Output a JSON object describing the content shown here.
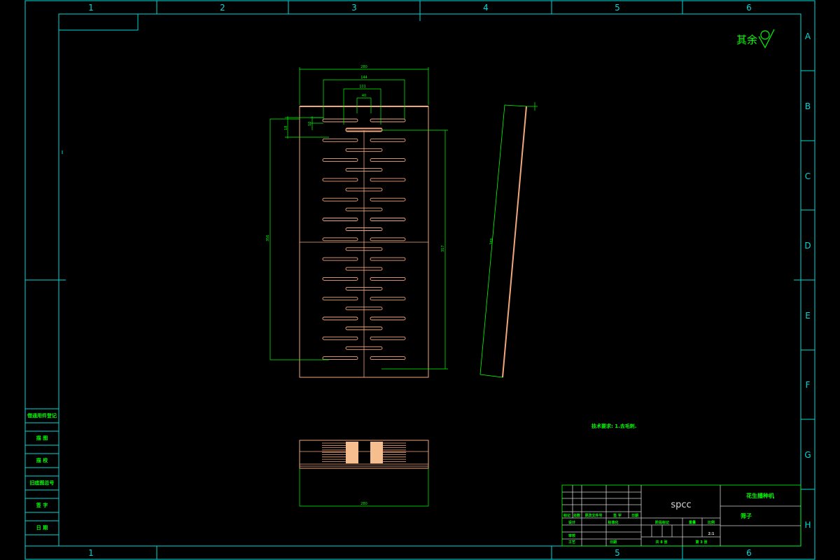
{
  "sheet": {
    "column_labels": [
      "1",
      "2",
      "3",
      "4",
      "5",
      "6"
    ],
    "bottom_column_labels": [
      "1",
      "5",
      "6"
    ],
    "row_labels": [
      "A",
      "B",
      "C",
      "D",
      "E",
      "F",
      "G",
      "H"
    ]
  },
  "surface_finish": {
    "label": "其余"
  },
  "dimensions": {
    "top_outer": "280",
    "top_middle": "144",
    "top_inner": "101",
    "top_slot": "40",
    "slot_height": "10",
    "slot_pitch": "18",
    "left_total": "356",
    "right_total": "317",
    "side_length": "388",
    "bottom_width": "280"
  },
  "technical_note": "技术要求: 1.去毛刺.",
  "left_strip": [
    "借通用件登记",
    "描 图",
    "描 校",
    "旧底图总号",
    "签 字",
    "日 期"
  ],
  "title_block": {
    "material": "spcc",
    "company": "花生播种机",
    "part_name": "筛子",
    "rev_headers": [
      "标记",
      "处数",
      "更改文件号",
      "签 字",
      "日期"
    ],
    "sign_rows": [
      "设计",
      "审核",
      "工艺"
    ],
    "standardize": "标准化",
    "approve": "日期",
    "stage_header": "阶段标记",
    "weight_header": "重量",
    "scale_header": "比例",
    "scale_value": "2:1",
    "sheets_total": "共 8 张",
    "sheet_no": "第 3 张"
  }
}
